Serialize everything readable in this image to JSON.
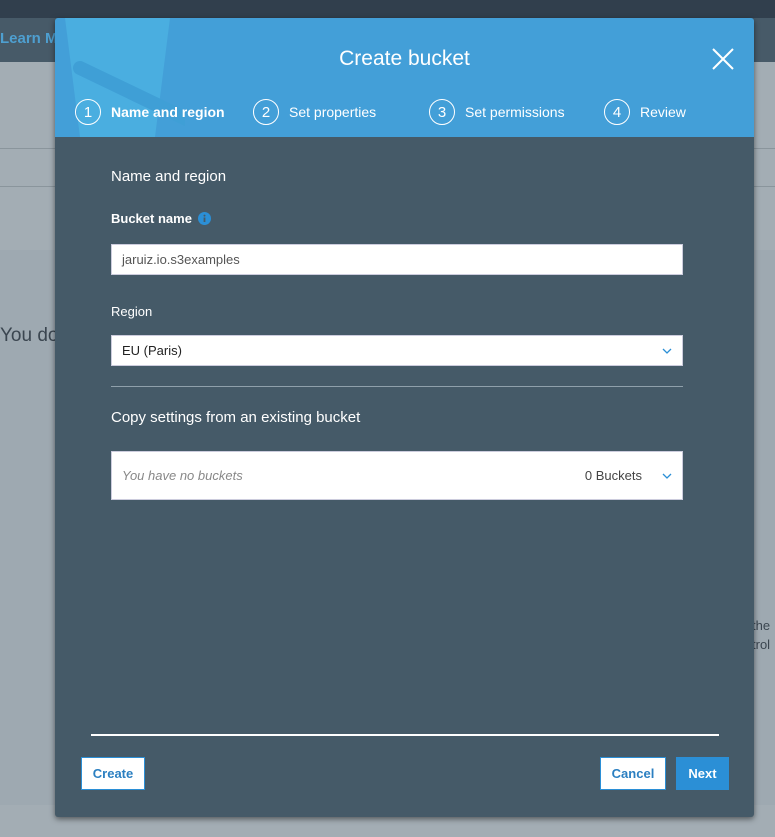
{
  "background": {
    "learn_link": "Learn M",
    "partial_text": "You do",
    "partial_right_1": "the",
    "partial_right_2": "trol"
  },
  "modal": {
    "title": "Create bucket",
    "steps": [
      {
        "num": "1",
        "label": "Name and region"
      },
      {
        "num": "2",
        "label": "Set properties"
      },
      {
        "num": "3",
        "label": "Set permissions"
      },
      {
        "num": "4",
        "label": "Review"
      }
    ],
    "section_title": "Name and region",
    "bucket_name_label": "Bucket name",
    "bucket_name_value": "jaruiz.io.s3examples",
    "region_label": "Region",
    "region_value": "EU (Paris)",
    "copy_title": "Copy settings from an existing bucket",
    "copy_placeholder": "You have no buckets",
    "copy_count": "0 Buckets",
    "create_label": "Create",
    "cancel_label": "Cancel",
    "next_label": "Next"
  },
  "colors": {
    "header": "#439fd8",
    "body": "#455a68",
    "primary": "#2b8fd6",
    "info": "#2b8fd6"
  }
}
